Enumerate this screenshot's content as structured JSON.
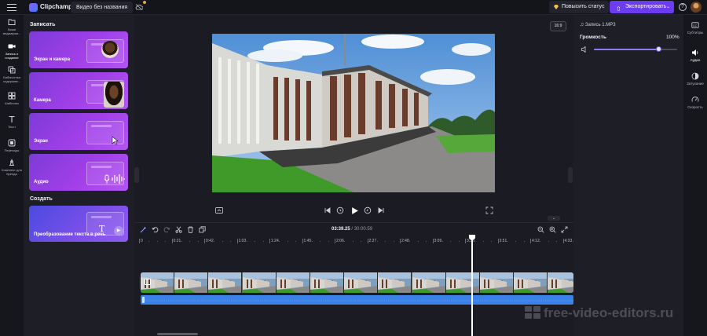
{
  "app": {
    "name": "Clipchamp",
    "project_name": "Видео без названия",
    "upgrade_label": "Повысить статус",
    "export_label": "Экспортировать",
    "export_chevron": "⌄",
    "help_glyph": "?",
    "colors": {
      "accent": "#6b3cf0",
      "card": "#9a3de2",
      "audio_track": "#3b82e8",
      "background": "#1b1b23"
    }
  },
  "left_rail": [
    {
      "icon": "media-icon",
      "label": "Ваши медиафаи..."
    },
    {
      "icon": "record-icon",
      "label": "Запись и создание"
    },
    {
      "icon": "content-library-icon",
      "label": "Библиотека содержим..."
    },
    {
      "icon": "templates-icon",
      "label": "Шаблоны"
    },
    {
      "icon": "text-icon",
      "label": "Текст"
    },
    {
      "icon": "transitions-icon",
      "label": "Переходы"
    },
    {
      "icon": "brand-kit-icon",
      "label": "Комплект для бренда"
    }
  ],
  "record_panel": {
    "section_record": "Записать",
    "cards": [
      {
        "label": "Экран и камера"
      },
      {
        "label": "Камера"
      },
      {
        "label": "Экран"
      },
      {
        "label": "Аудио"
      }
    ],
    "section_create": "Создать",
    "tts_card": "Преобразование текста в речь"
  },
  "preview": {
    "aspect_ratio": "16:9"
  },
  "right_panel": {
    "file_name": "Запись 1.MP3",
    "volume_label": "Громкость",
    "volume_value": "100%",
    "volume_level": 0.78
  },
  "right_tabs": [
    {
      "icon": "captions-icon",
      "label": "Субтитры"
    },
    {
      "icon": "audio-icon",
      "label": "Аудио"
    },
    {
      "icon": "fade-icon",
      "label": "Затухание"
    },
    {
      "icon": "speed-icon",
      "label": "Скорость"
    }
  ],
  "timeline": {
    "current_time": "03:39.25",
    "total_time": "/ 30:00.59",
    "ticks": [
      "0",
      "0:21",
      "0:42",
      "1:03",
      "1:24",
      "1:45",
      "2:06",
      "2:27",
      "2:48",
      "3:09",
      "3:30",
      "3:51",
      "4:12",
      "4:33"
    ]
  },
  "watermark": "free-video-editors.ru"
}
